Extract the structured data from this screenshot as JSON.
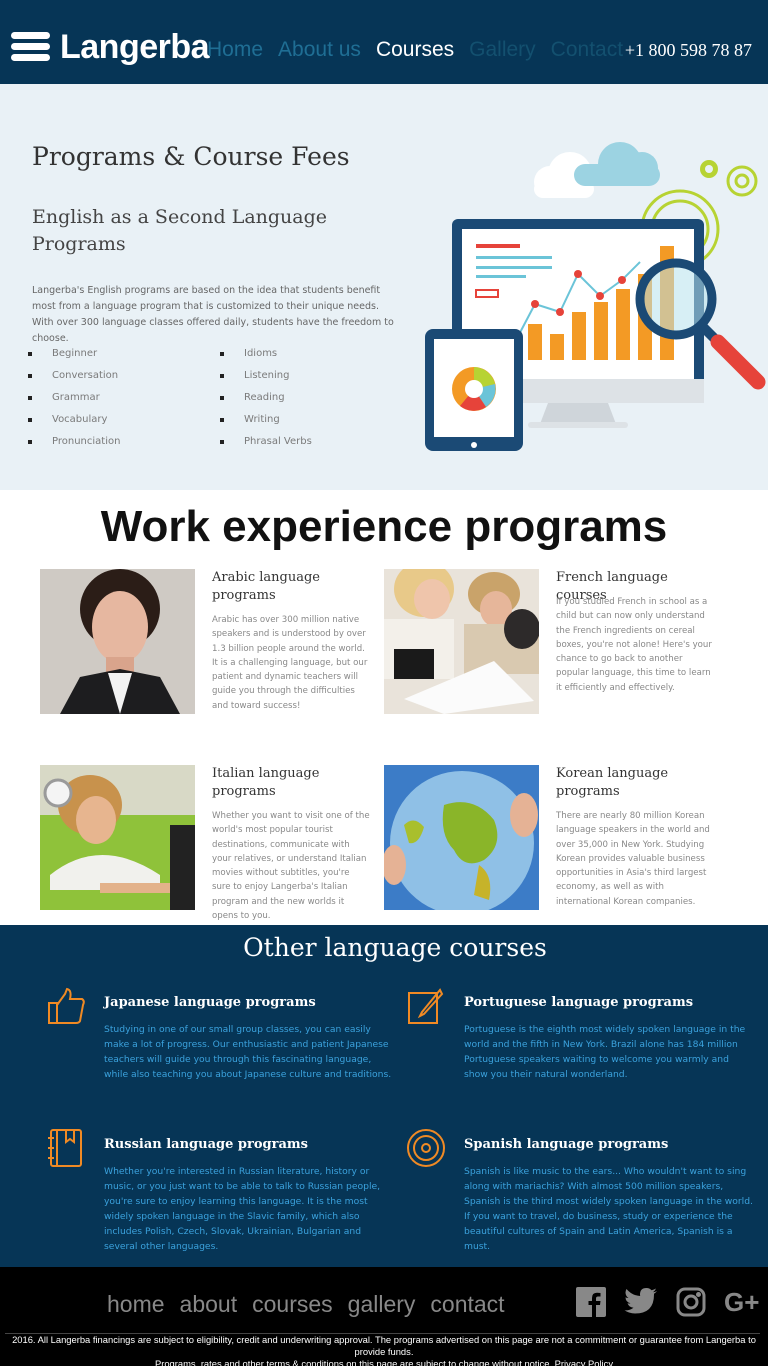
{
  "header": {
    "logo": "Langerba",
    "nav": [
      "Home",
      "About us",
      "Courses",
      "Gallery",
      "Contact"
    ],
    "phone": "+1 800 598 78 87"
  },
  "hero": {
    "title": "Programs & Course Fees",
    "subtitle": "English as a Second Language Programs",
    "text": "Langerba's English programs are based on the idea that students benefit most from a language program that is customized to their unique needs. With over 300 language classes offered daily, students have the freedom to choose.",
    "list_left": [
      "Beginner",
      "Conversation",
      "Grammar",
      "Vocabulary",
      "Pronunciation"
    ],
    "list_right": [
      "Idioms",
      "Listening",
      "Reading",
      "Writing",
      "Phrasal Verbs"
    ]
  },
  "work": {
    "title": "Work experience programs",
    "programs": [
      {
        "title": "Arabic language programs",
        "text": "Arabic has over 300 million native speakers and is understood by over 1.3 billion people around the world. It is a challenging language, but our patient and dynamic teachers will guide you through the difficulties and toward success!"
      },
      {
        "title": "French language courses",
        "text": "If you studied French in school as a child but can now only understand the French ingredients on cereal boxes, you're not alone! Here's your chance to go back to another popular language, this time to learn it efficiently and effectively."
      },
      {
        "title": "Italian language programs",
        "text": "Whether you want to visit one of the world's most popular tourist destinations, communicate with your relatives, or understand Italian movies without subtitles, you're sure to enjoy Langerba's Italian program and the new worlds it opens to you."
      },
      {
        "title": "Korean language programs",
        "text": "There are nearly 80 million Korean language speakers in the world and over 35,000 in New York. Studying Korean provides valuable business opportunities in Asia's third largest economy, as well as with international Korean companies."
      }
    ]
  },
  "other": {
    "title": "Other language courses",
    "courses": [
      {
        "icon": "thumbs-up-icon",
        "title": "Japanese language programs",
        "text": "Studying in one of our small group classes, you can easily make a lot of progress. Our enthusiastic and patient Japanese teachers will guide you through this fascinating language, while also teaching you about Japanese culture and traditions."
      },
      {
        "icon": "edit-icon",
        "title": "Portuguese language programs",
        "text": "Portuguese is the eighth most widely spoken language in the world and the fifth in New York. Brazil alone has 184 million Portuguese speakers waiting to welcome you warmly and show you their natural wonderland."
      },
      {
        "icon": "book-icon",
        "title": "Russian language programs",
        "text": "Whether you're interested in Russian literature, history or music, or you just want to be able to talk to Russian people, you're sure to enjoy learning this language. It is the most widely spoken language in the Slavic family, which also includes Polish, Czech, Slovak, Ukrainian, Bulgarian and several other languages."
      },
      {
        "icon": "disc-icon",
        "title": "Spanish language programs",
        "text": "Spanish is like music to the ears... Who wouldn't want to sing along with mariachis? With almost 500 million speakers, Spanish is the third most widely spoken language in the world. If you want to travel, do business, study or experience the beautiful cultures of Spain and Latin America, Spanish is a must."
      }
    ]
  },
  "footer": {
    "nav": [
      "home",
      "about",
      "courses",
      "gallery",
      "contact"
    ],
    "social": [
      "facebook-icon",
      "twitter-icon",
      "instagram-icon",
      "google-plus-icon"
    ],
    "legal_1": "2016. All Langerba financings are subject to eligibility, credit and underwriting approval. The programs advertised on this page are not a commitment or guarantee from Langerba to provide funds.",
    "legal_2": "Programs, rates and other terms & conditions on this page are subject to change without notice. Privacy Policy"
  },
  "colors": {
    "navy": "#063556",
    "orange": "#f08a24",
    "link_blue": "#3ba2dd"
  }
}
